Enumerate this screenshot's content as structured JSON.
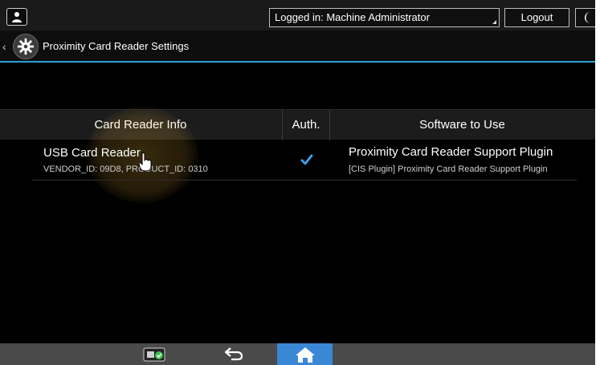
{
  "topbar": {
    "user_icon": "user-icon",
    "login_status": "Logged in: Machine Administrator",
    "logout_label": "Logout",
    "energy_icon": "moon-icon"
  },
  "titlebar": {
    "back_icon": "chevron-left-icon",
    "settings_icon": "gear-icon",
    "title": "Proximity Card Reader Settings"
  },
  "table": {
    "headers": {
      "info": "Card Reader Info",
      "auth": "Auth.",
      "software": "Software to Use"
    },
    "rows": [
      {
        "name": "USB Card Reader",
        "ids": "VENDOR_ID: 09D8, PRODUCT_ID: 0310",
        "auth_checked": true,
        "plugin": "Proximity Card Reader Support Plugin",
        "plugin_detail": "[CIS Plugin] Proximity Card Reader Support Plugin"
      }
    ]
  },
  "bottombar": {
    "icons": [
      "card-status-icon",
      "back-arrow-icon",
      "home-icon"
    ]
  },
  "colors": {
    "accent": "#2f9fd2",
    "home_button": "#3a87d6",
    "check": "#3ea0e8"
  }
}
